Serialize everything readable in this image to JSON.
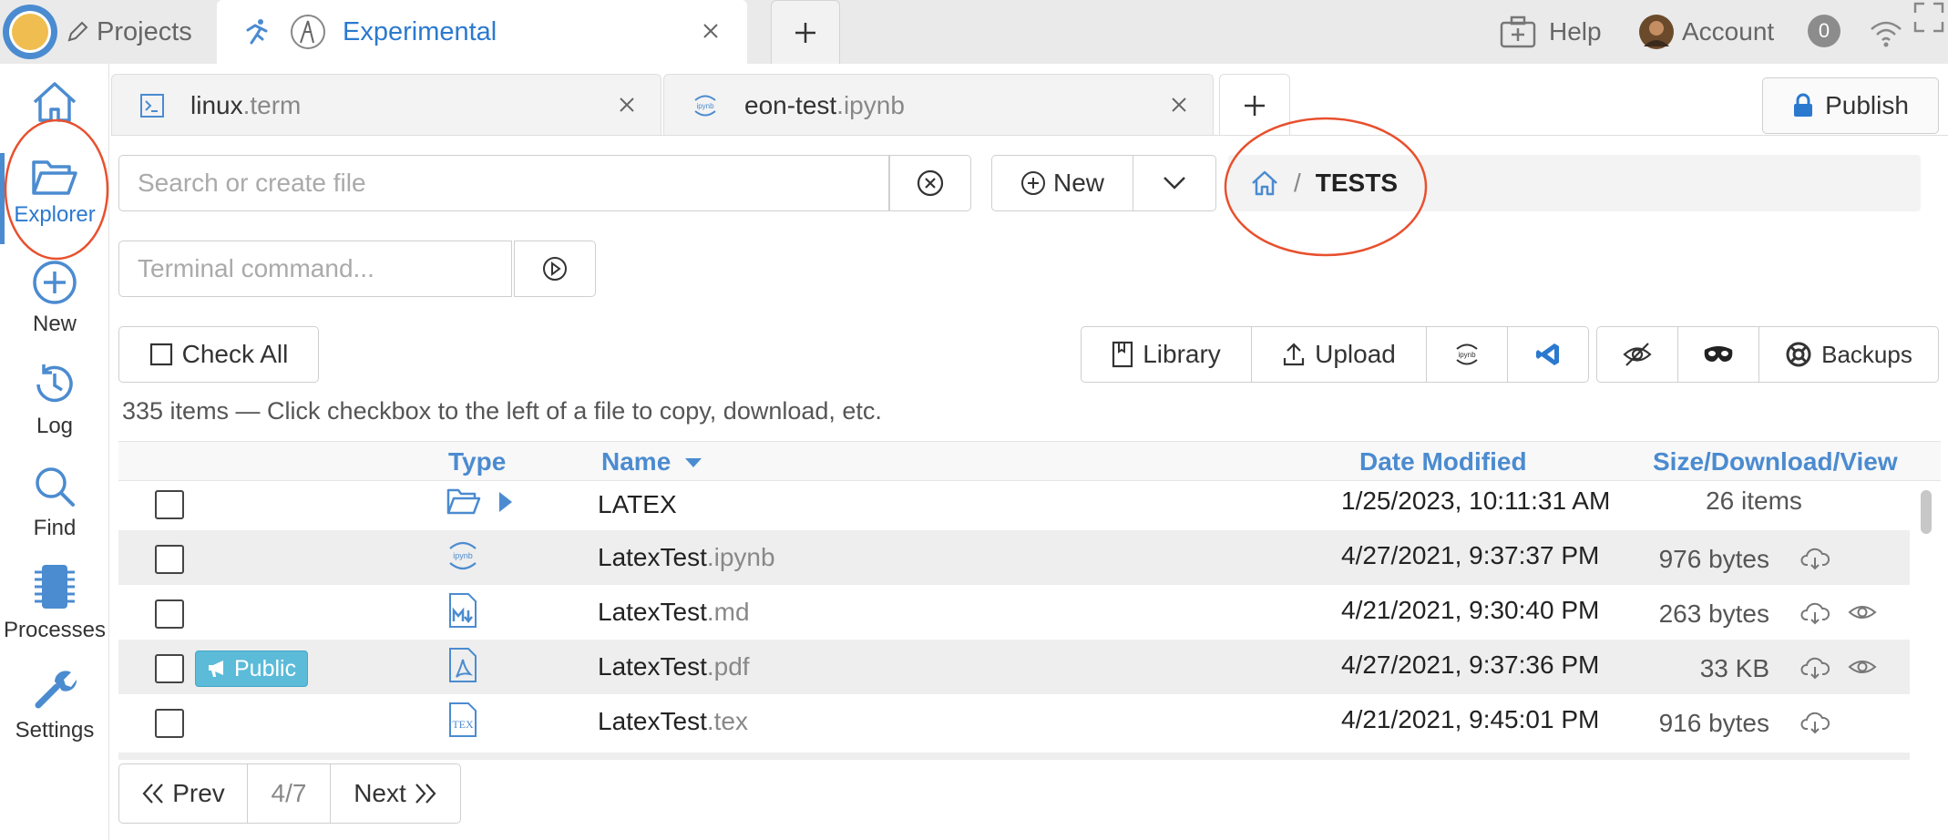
{
  "topbar": {
    "projects_label": "Projects",
    "project_title": "Experimental",
    "help_label": "Help",
    "account_label": "Account",
    "notifications_count": "0"
  },
  "sidebar": {
    "items": [
      {
        "label": ""
      },
      {
        "label": "Explorer"
      },
      {
        "label": "New"
      },
      {
        "label": "Log"
      },
      {
        "label": "Find"
      },
      {
        "label": "Processes"
      },
      {
        "label": "Settings"
      }
    ]
  },
  "file_tabs": [
    {
      "name": "linux",
      "ext": ".term"
    },
    {
      "name": "eon-test",
      "ext": ".ipynb"
    }
  ],
  "publish_label": "Publish",
  "search": {
    "placeholder": "Search or create file"
  },
  "new_label": "New",
  "breadcrumb": {
    "current": "TESTS",
    "separator": "/"
  },
  "terminal": {
    "placeholder": "Terminal command..."
  },
  "check_all_label": "Check All",
  "toolbar": {
    "library": "Library",
    "upload": "Upload",
    "ipynb_icon_text": "ipynb",
    "backups": "Backups"
  },
  "status_line": "335 items — Click checkbox to the left of a file to copy, download, etc.",
  "table": {
    "headers": {
      "type": "Type",
      "name": "Name",
      "date": "Date Modified",
      "size": "Size/Download/View"
    },
    "rows": [
      {
        "name": "LATEX",
        "ext": "",
        "date": "1/25/2023, 10:11:31 AM",
        "size": "26 items",
        "type_icon": "folder-open-icon",
        "public": false
      },
      {
        "name": "LatexTest",
        "ext": ".ipynb",
        "date": "4/27/2021, 9:37:37 PM",
        "size": "976 bytes",
        "type_icon": "jupyter-icon",
        "public": false
      },
      {
        "name": "LatexTest",
        "ext": ".md",
        "date": "4/21/2021, 9:30:40 PM",
        "size": "263 bytes",
        "type_icon": "markdown-icon",
        "public": false
      },
      {
        "name": "LatexTest",
        "ext": ".pdf",
        "date": "4/27/2021, 9:37:36 PM",
        "size": "33 KB",
        "type_icon": "pdf-icon",
        "public": true,
        "public_label": "Public"
      },
      {
        "name": "LatexTest",
        "ext": ".tex",
        "date": "4/21/2021, 9:45:01 PM",
        "size": "916 bytes",
        "type_icon": "tex-icon",
        "public": false
      }
    ]
  },
  "pagination": {
    "prev": "Prev",
    "page": "4/7",
    "next": "Next"
  },
  "colors": {
    "accent": "#4b8bd0",
    "annotation": "#e8502e",
    "public_badge": "#5bbbd9"
  }
}
